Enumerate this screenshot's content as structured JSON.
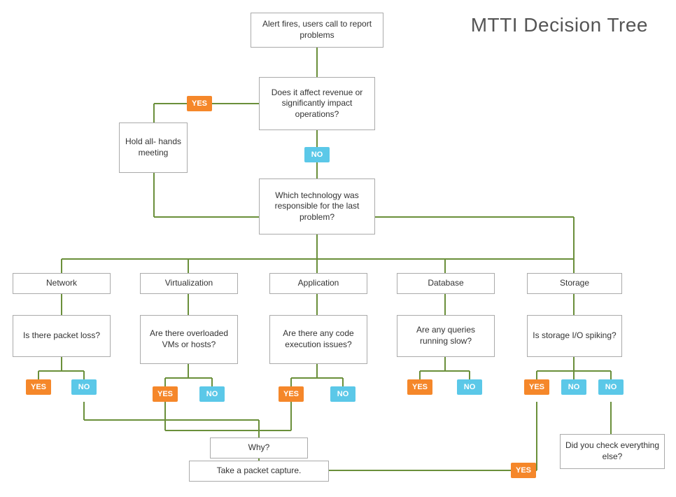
{
  "title": "MTTI Decision Tree",
  "nodes": {
    "start": {
      "label": "Alert fires, users call to\nreport problems"
    },
    "q1": {
      "label": "Does it affect revenue\nor significantly impact\noperations?"
    },
    "hold": {
      "label": "Hold all-\nhands\nmeeting"
    },
    "q2": {
      "label": "Which technology was\nresponsible for the last\nproblem?"
    },
    "network": {
      "label": "Network"
    },
    "virtualization": {
      "label": "Virtualization"
    },
    "application": {
      "label": "Application"
    },
    "database": {
      "label": "Database"
    },
    "storage": {
      "label": "Storage"
    },
    "q_network": {
      "label": "Is there packet\nloss?"
    },
    "q_virt": {
      "label": "Are there\noverloaded\nVMs or hosts?"
    },
    "q_app": {
      "label": "Are there any\ncode execution\nissues?"
    },
    "q_db": {
      "label": "Are any queries\nrunning slow?"
    },
    "q_stor": {
      "label": "Is storage I/O\nspiking?"
    },
    "why": {
      "label": "Why?"
    },
    "packet": {
      "label": "Take a packet capture."
    },
    "check_else": {
      "label": "Did you check\neverything else?"
    }
  },
  "badges": {
    "yes_label": "YES",
    "no_label": "NO"
  }
}
